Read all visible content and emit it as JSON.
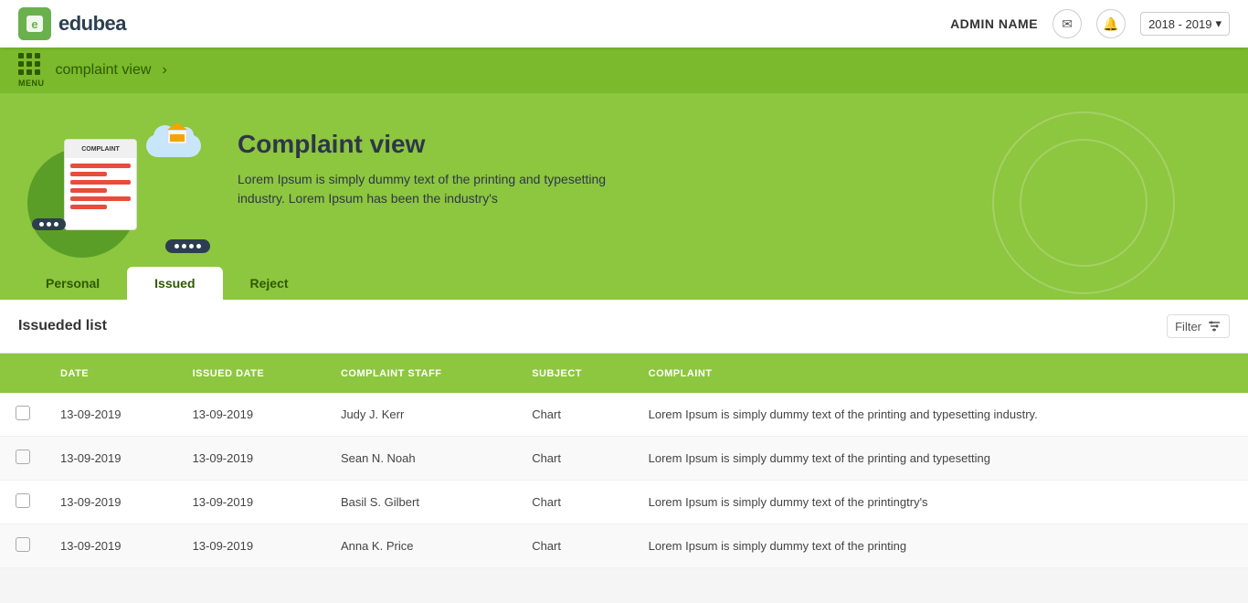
{
  "navbar": {
    "logo_letter": "e",
    "logo_brand": "edubea",
    "admin_label": "ADMIN NAME",
    "year_label": "2018 - 2019",
    "year_chevron": "▾"
  },
  "breadcrumb": {
    "menu_label": "MENU",
    "path_text": "complaint view",
    "arrow": "›"
  },
  "hero": {
    "illustration_text": "COMPLAINT",
    "title": "Complaint view",
    "description": "Lorem Ipsum is simply dummy text of the printing and typesetting industry. Lorem Ipsum has been the industry's"
  },
  "tabs": [
    {
      "id": "personal",
      "label": "Personal",
      "active": false
    },
    {
      "id": "issued",
      "label": "Issued",
      "active": true
    },
    {
      "id": "reject",
      "label": "Reject",
      "active": false
    }
  ],
  "table": {
    "section_title": "Issueded list",
    "filter_label": "Filter",
    "columns": [
      {
        "id": "select",
        "label": ""
      },
      {
        "id": "date",
        "label": "DATE"
      },
      {
        "id": "issued_date",
        "label": "ISSUED DATE"
      },
      {
        "id": "complaint_staff",
        "label": "COMPLAINT STAFF"
      },
      {
        "id": "subject",
        "label": "SUBJECT"
      },
      {
        "id": "complaint",
        "label": "COMPLAINT"
      }
    ],
    "rows": [
      {
        "date": "13-09-2019",
        "issued_date": "13-09-2019",
        "complaint_staff": "Judy J. Kerr",
        "subject": "Chart",
        "complaint": "Lorem Ipsum is simply dummy text of the printing and typesetting industry."
      },
      {
        "date": "13-09-2019",
        "issued_date": "13-09-2019",
        "complaint_staff": "Sean N. Noah",
        "subject": "Chart",
        "complaint": "Lorem Ipsum is simply dummy text of the printing and typesetting"
      },
      {
        "date": "13-09-2019",
        "issued_date": "13-09-2019",
        "complaint_staff": "Basil S. Gilbert",
        "subject": "Chart",
        "complaint": "Lorem Ipsum is simply dummy text of the printingtry's"
      },
      {
        "date": "13-09-2019",
        "issued_date": "13-09-2019",
        "complaint_staff": "Anna K. Price",
        "subject": "Chart",
        "complaint": "Lorem Ipsum is simply dummy text of the printing"
      }
    ]
  }
}
